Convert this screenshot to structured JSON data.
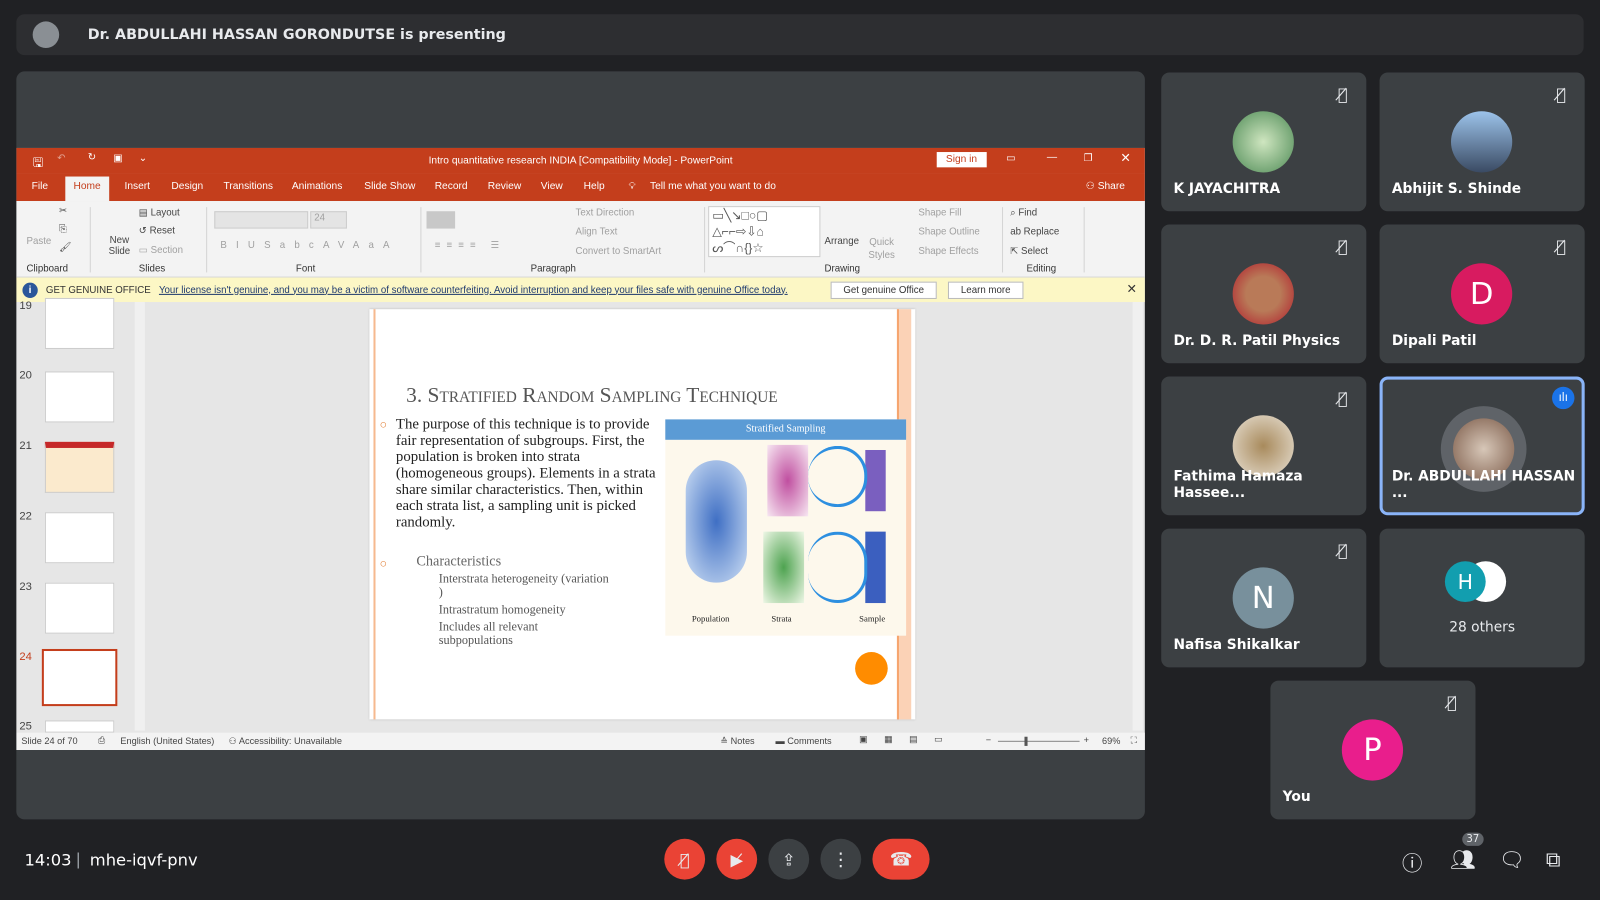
{
  "presenting_banner": "Dr. ABDULLAHI HASSAN GORONDUTSE is presenting",
  "powerpoint": {
    "title": "Intro quantitative research INDIA [Compatibility Mode]  -  PowerPoint",
    "sign_in": "Sign in",
    "tabs": [
      "File",
      "Home",
      "Insert",
      "Design",
      "Transitions",
      "Animations",
      "Slide Show",
      "Record",
      "Review",
      "View",
      "Help"
    ],
    "active_tab": "Home",
    "tell_me": "Tell me what you want to do",
    "share": "Share",
    "ribbon": {
      "paste": "Paste",
      "clipboard": "Clipboard",
      "new_slide": "New Slide",
      "layout": "Layout",
      "reset": "Reset",
      "section": "Section",
      "slides": "Slides",
      "font_size": "24",
      "font": "Font",
      "text_direction": "Text Direction",
      "align_text": "Align Text",
      "convert_smartart": "Convert to SmartArt",
      "paragraph": "Paragraph",
      "arrange": "Arrange",
      "quick_styles": "Quick Styles",
      "shape_fill": "Shape Fill",
      "shape_outline": "Shape Outline",
      "shape_effects": "Shape Effects",
      "drawing": "Drawing",
      "find": "Find",
      "replace": "Replace",
      "select": "Select",
      "editing": "Editing"
    },
    "warning": {
      "title": "GET GENUINE OFFICE",
      "message": "Your license isn't genuine, and you may be a victim of software counterfeiting. Avoid interruption and keep your files safe with genuine Office today.",
      "get_button": "Get genuine Office",
      "learn_button": "Learn more"
    },
    "thumbnails": [
      "19",
      "20",
      "21",
      "22",
      "23",
      "24",
      "25"
    ],
    "selected_slide": "24",
    "slide": {
      "title": "3. Stratified Random Sampling Technique",
      "body": "The purpose of this technique is to provide fair representation of subgroups. First, the population is broken into strata (homogeneous groups). Elements in a strata share similar characteristics. Then, within each strata list, a sampling unit is picked randomly.",
      "characteristics": "Characteristics",
      "bullets": [
        "Interstrata heterogeneity (variation )",
        "Intrastratum homogeneity",
        "Includes all relevant subpopulations"
      ],
      "image_title": "Stratified Sampling",
      "image_labels": [
        "Population",
        "Strata",
        "Sample"
      ]
    },
    "status": {
      "slide_count": "Slide 24 of 70",
      "language": "English (United States)",
      "accessibility": "Accessibility: Unavailable",
      "notes": "Notes",
      "comments": "Comments",
      "zoom": "69%"
    }
  },
  "participants": [
    {
      "name": "K JAYACHITRA",
      "muted": true
    },
    {
      "name": "Abhijit S. Shinde",
      "muted": true
    },
    {
      "name": "Dr. D. R. Patil Physics",
      "muted": true
    },
    {
      "name": "Dipali Patil",
      "muted": true,
      "initial": "D",
      "color": "#d81b60"
    },
    {
      "name": "Fathima Hamaza Hassee...",
      "muted": true
    },
    {
      "name": "Dr. ABDULLAHI HASSAN ...",
      "muted": false,
      "speaking": true
    },
    {
      "name": "Nafisa Shikalkar",
      "muted": true,
      "initial": "N",
      "color": "#78909c"
    },
    {
      "name": "You",
      "muted": true,
      "initial": "P",
      "color": "#e91e8c"
    }
  ],
  "others": {
    "label": "28 others",
    "initial": "H",
    "color": "#129eaf"
  },
  "bottom": {
    "time": "14:03",
    "meeting_code": "mhe-iqvf-pnv",
    "people_count": "37"
  },
  "colors": {
    "accent": "#c43e1c",
    "end_call": "#ea4335",
    "speaking": "#8ab4f8"
  }
}
